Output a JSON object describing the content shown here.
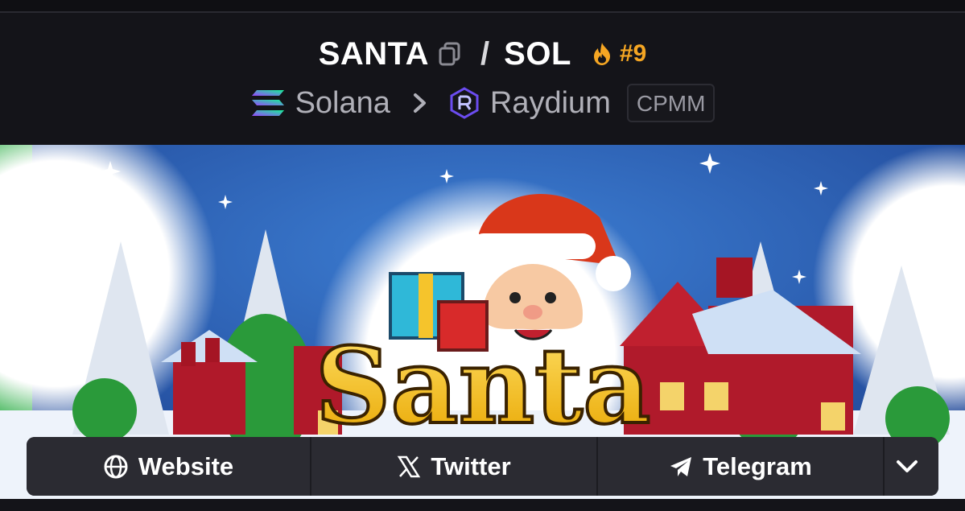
{
  "header": {
    "base_symbol": "SANTA",
    "separator": "/",
    "quote_symbol": "SOL",
    "trending_rank": "#9",
    "chain_name": "Solana",
    "dex_name": "Raydium",
    "pool_type": "CPMM"
  },
  "banner": {
    "logo_text": "Santa"
  },
  "links": {
    "website_label": "Website",
    "twitter_label": "Twitter",
    "telegram_label": "Telegram"
  },
  "colors": {
    "background": "#141419",
    "rank": "#f5a623",
    "button": "#2b2b32",
    "solana_gradient": [
      "#9945ff",
      "#14f195"
    ],
    "raydium": "#5a3fd6"
  },
  "icons": [
    "copy-icon",
    "flame-icon",
    "solana-icon",
    "chevron-right-icon",
    "raydium-icon",
    "globe-icon",
    "x-icon",
    "telegram-icon",
    "chevron-down-icon"
  ]
}
